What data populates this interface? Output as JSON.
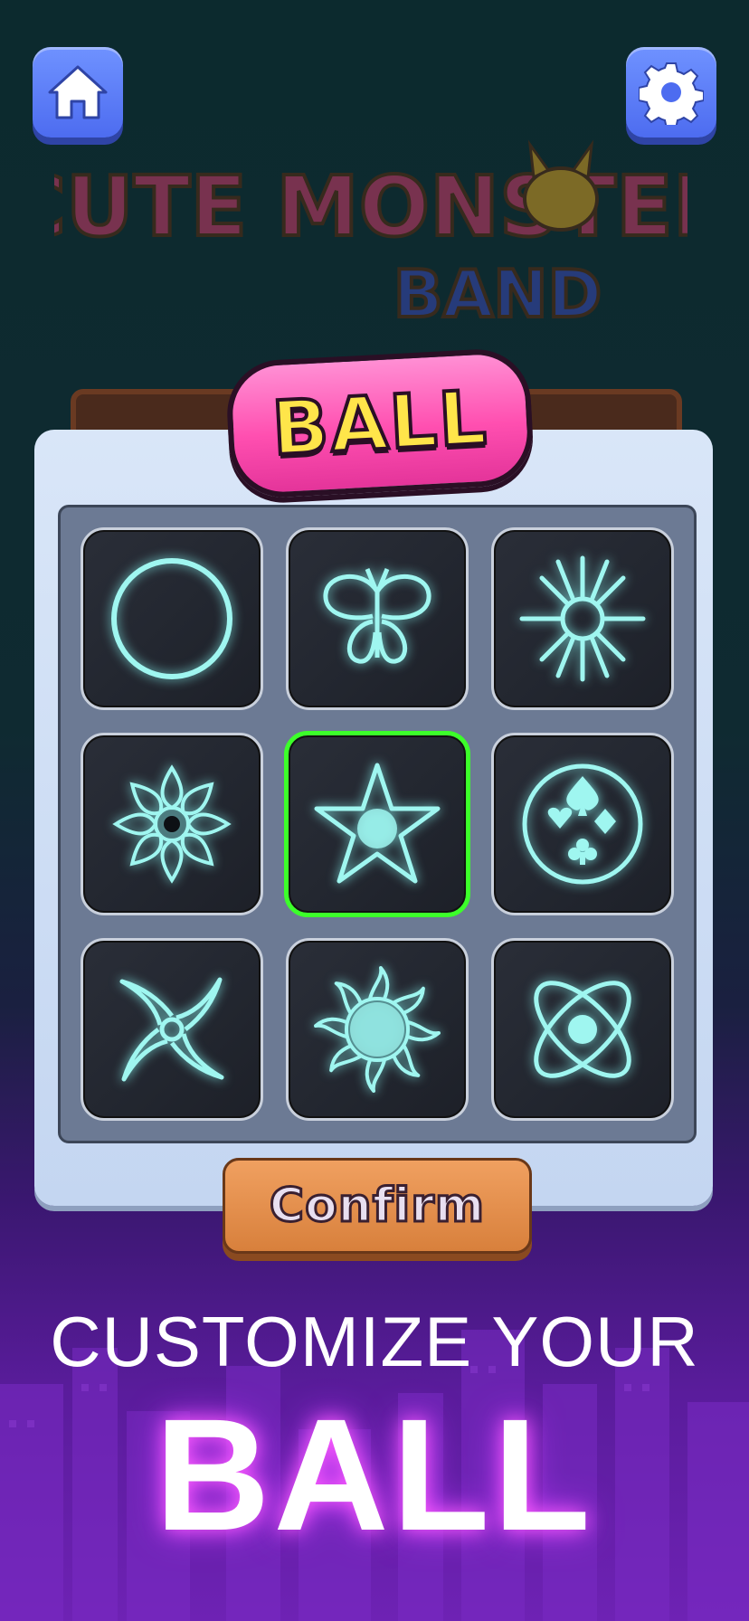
{
  "header": {
    "home_icon": "home-icon",
    "settings_icon": "gear-icon"
  },
  "logo": {
    "line1": "CUTE MONSTER",
    "line2": "BAND"
  },
  "panel": {
    "title": "BALL",
    "selected_index": 4,
    "balls": [
      {
        "name": "circle-ball-icon"
      },
      {
        "name": "butterfly-ball-icon"
      },
      {
        "name": "sun-rays-ball-icon"
      },
      {
        "name": "flower-ball-icon"
      },
      {
        "name": "star-ball-icon"
      },
      {
        "name": "card-suits-ball-icon"
      },
      {
        "name": "shuriken-ball-icon"
      },
      {
        "name": "flame-sun-ball-icon"
      },
      {
        "name": "atom-ball-icon"
      }
    ],
    "confirm_label": "Confirm"
  },
  "promo": {
    "line1": "CUSTOMIZE YOUR",
    "line2": "BALL"
  },
  "colors": {
    "glow": "#9ff6f0",
    "selected_border": "#3cff2a",
    "title_fill": "#ffe54a",
    "title_badge": "#ff4fb0"
  }
}
